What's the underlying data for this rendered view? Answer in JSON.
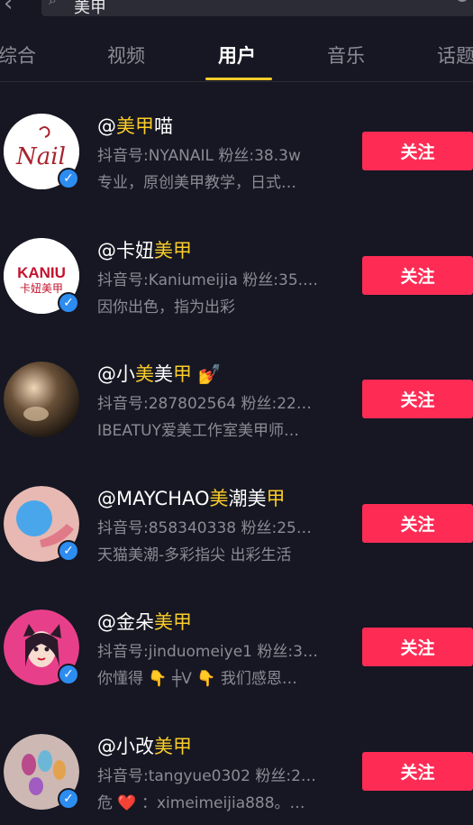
{
  "search": {
    "query": "美甲"
  },
  "tabs": [
    {
      "label": "综合"
    },
    {
      "label": "视频"
    },
    {
      "label": "用户"
    },
    {
      "label": "音乐"
    },
    {
      "label": "话题"
    }
  ],
  "users": [
    {
      "name_prefix": "@",
      "name_parts": [
        "",
        "美甲",
        "喵"
      ],
      "meta": "抖音号:NYANAIL  粉丝:38.3w",
      "desc": "专业，原创美甲教学，日式…",
      "follow": "关注",
      "avatar_color": "#ffffff",
      "avatar_text": "Nail"
    },
    {
      "name_prefix": "@",
      "name_parts": [
        "卡妞",
        "美甲",
        ""
      ],
      "meta": "抖音号:Kaniumeijia  粉丝:35.…",
      "desc": "因你出色，指为出彩",
      "follow": "关注",
      "avatar_color": "#ffffff",
      "avatar_text": "KANIU\n卡妞美甲"
    },
    {
      "name_prefix": "@",
      "name_parts": [
        "小",
        "美",
        "美",
        "甲"
      ],
      "meta": "抖音号:287802564  粉丝:22…",
      "desc": "IBEATUY爱美工作室美甲师…",
      "follow": "关注",
      "avatar_color": "#2a241c",
      "avatar_text": ""
    },
    {
      "name_prefix": "@",
      "name_parts": [
        "MAYCHAO",
        "美",
        "潮美",
        "甲"
      ],
      "meta": "抖音号:858340338  粉丝:25…",
      "desc": "天猫美潮-多彩指尖 出彩生活",
      "follow": "关注",
      "avatar_color": "#d9a5a0",
      "avatar_text": ""
    },
    {
      "name_prefix": "@",
      "name_parts": [
        "金朵",
        "美甲",
        ""
      ],
      "meta": "抖音号:jinduomeiye1  粉丝:3…",
      "desc": "你懂得 👇 ╪V 👇 我们感恩…",
      "follow": "关注",
      "avatar_color": "#e83f8a",
      "avatar_text": ""
    },
    {
      "name_prefix": "@",
      "name_parts": [
        "小改",
        "美甲",
        ""
      ],
      "meta": "抖音号:tangyue0302  粉丝:2…",
      "desc": "危 ❤️ ：ximeimeijia888。…",
      "follow": "关注",
      "avatar_color": "#c9b6b0",
      "avatar_text": ""
    }
  ],
  "colors": {
    "background": "#161722",
    "accent": "#facc2a",
    "follow": "#fe2c55",
    "verified": "#2d8cf0"
  }
}
